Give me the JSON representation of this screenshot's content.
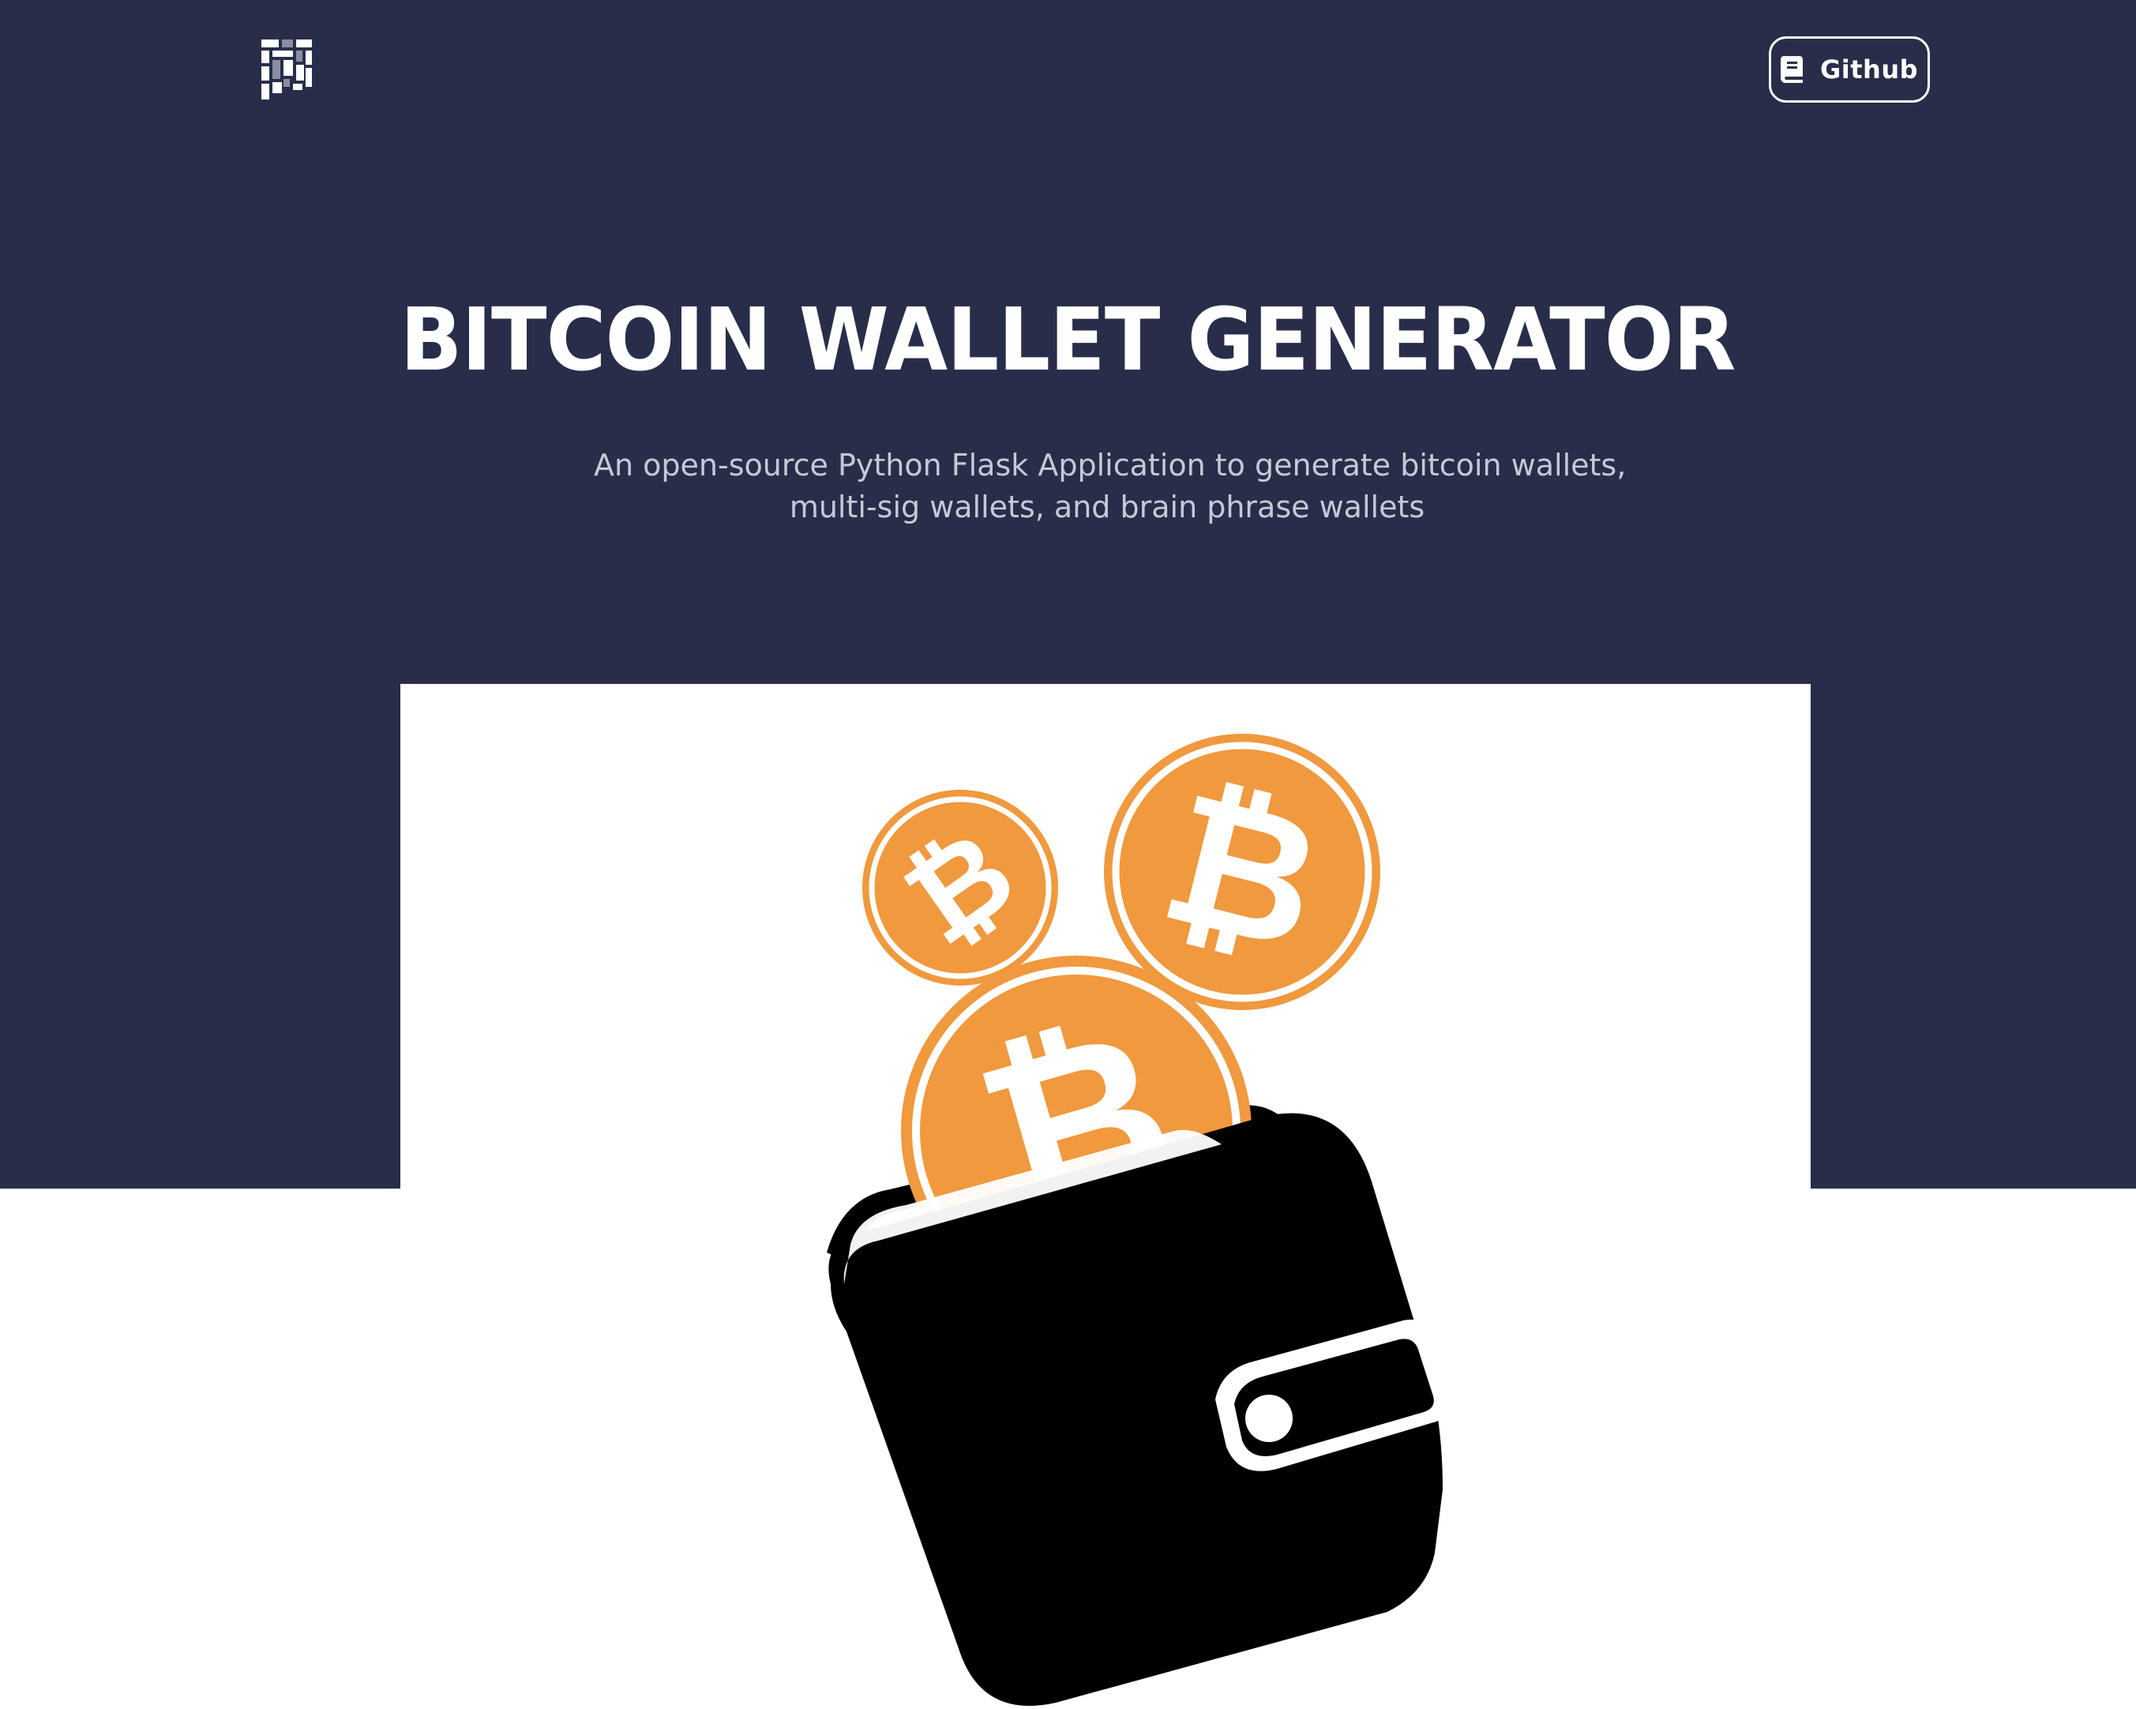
{
  "header": {
    "logo_icon": "app-logo-icon",
    "github_button": {
      "label": "Github",
      "icon": "book-icon"
    }
  },
  "hero": {
    "title": "BITCOIN WALLET GENERATOR",
    "subtitle_line1": "An open-source Python Flask Application to generate bitcoin wallets,",
    "subtitle_line2": "multi-sig wallets, and brain phrase wallets",
    "image": {
      "subject": "wallet-with-bitcoins-illustration",
      "coin_symbol": "₿"
    }
  },
  "colors": {
    "hero_background": "#282e49",
    "text_primary": "#ffffff",
    "text_secondary": "#c6c9d6",
    "bitcoin_orange": "#f0993e",
    "wallet_black": "#000000"
  }
}
